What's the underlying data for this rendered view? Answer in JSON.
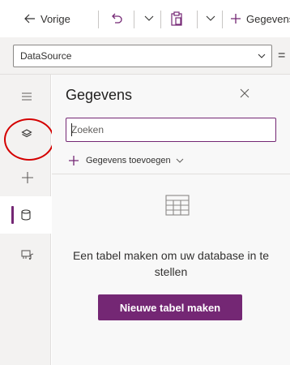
{
  "toolbar": {
    "back_label": "Vorige",
    "add_label": "Gegevens"
  },
  "formula_bar": {
    "property_value": "DataSource",
    "equals_sign": "="
  },
  "rail": {
    "items": [
      {
        "icon": "hamburger-icon"
      },
      {
        "icon": "layers-icon"
      },
      {
        "icon": "plus-icon"
      },
      {
        "icon": "database-icon",
        "active": true
      },
      {
        "icon": "media-icon"
      }
    ],
    "accent_color": "#742774",
    "highlight_color": "#d40000"
  },
  "panel": {
    "title": "Gegevens",
    "search_placeholder": "Zoeken",
    "add_data_label": "Gegevens toevoegen",
    "empty_message": "Een tabel maken om uw database in te stellen",
    "new_table_button": "Nieuwe tabel maken"
  }
}
